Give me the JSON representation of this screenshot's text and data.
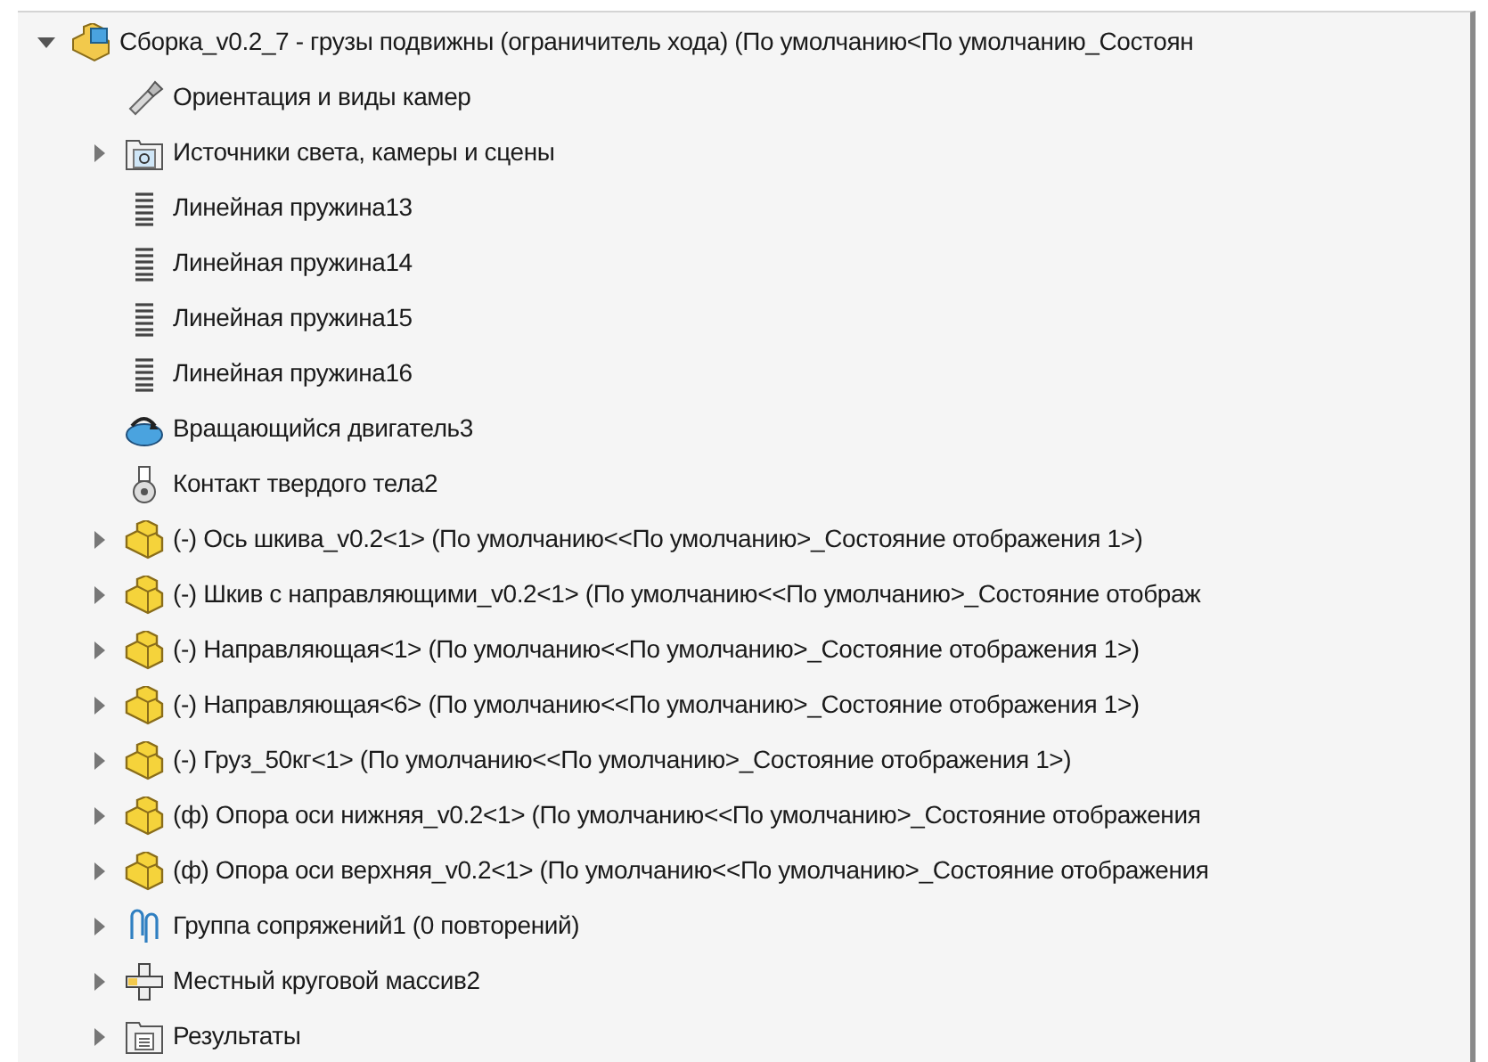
{
  "tree": [
    {
      "kind": "assembly",
      "expanded": true,
      "label": "Сборка_v0.2_7 - грузы подвижны (ограничитель хода)  (По умолчанию<По умолчанию_Состоян",
      "children": [
        {
          "kind": "camera",
          "label": "Ориентация и виды камер"
        },
        {
          "kind": "lights",
          "expanded": false,
          "label": "Источники света, камеры и сцены"
        },
        {
          "kind": "spring",
          "label": "Линейная пружина13"
        },
        {
          "kind": "spring",
          "label": "Линейная пружина14"
        },
        {
          "kind": "spring",
          "label": "Линейная пружина15"
        },
        {
          "kind": "spring",
          "label": "Линейная пружина16"
        },
        {
          "kind": "motor",
          "label": "Вращающийся двигатель3"
        },
        {
          "kind": "contact",
          "label": "Контакт твердого тела2"
        },
        {
          "kind": "part",
          "expanded": false,
          "label": "(-) Ось шкива_v0.2<1> (По умолчанию<<По умолчанию>_Состояние отображения 1>)"
        },
        {
          "kind": "part",
          "expanded": false,
          "label": "(-) Шкив с направляющими_v0.2<1> (По умолчанию<<По умолчанию>_Состояние отображ"
        },
        {
          "kind": "part",
          "expanded": false,
          "label": "(-) Направляющая<1> (По умолчанию<<По умолчанию>_Состояние отображения 1>)"
        },
        {
          "kind": "part",
          "expanded": false,
          "label": "(-) Направляющая<6> (По умолчанию<<По умолчанию>_Состояние отображения 1>)"
        },
        {
          "kind": "part",
          "expanded": false,
          "label": "(-) Груз_50кг<1> (По умолчанию<<По умолчанию>_Состояние отображения 1>)"
        },
        {
          "kind": "part",
          "expanded": false,
          "label": "(ф) Опора оси нижняя_v0.2<1> (По умолчанию<<По умолчанию>_Состояние отображения"
        },
        {
          "kind": "part",
          "expanded": false,
          "label": "(ф) Опора оси верхняя_v0.2<1> (По умолчанию<<По умолчанию>_Состояние отображения"
        },
        {
          "kind": "mates",
          "expanded": false,
          "label": "Группа сопряжений1 (0 повторений)"
        },
        {
          "kind": "pattern",
          "expanded": false,
          "label": "Местный круговой массив2"
        },
        {
          "kind": "results",
          "expanded": false,
          "label": "Результаты"
        }
      ]
    }
  ]
}
